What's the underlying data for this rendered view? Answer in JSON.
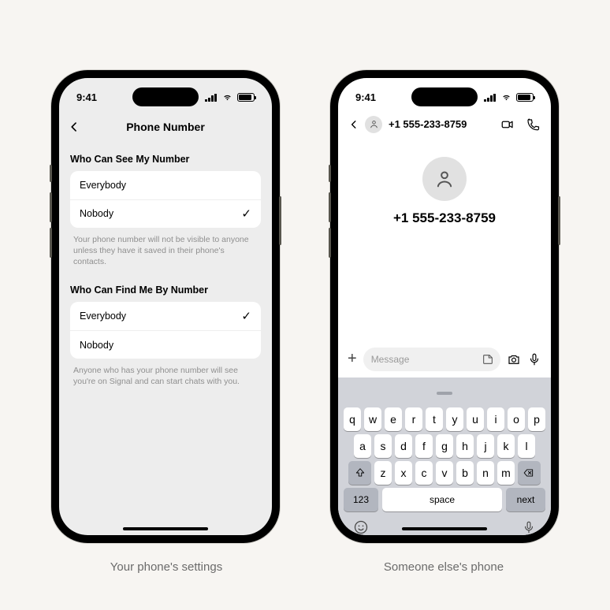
{
  "status_time": "9:41",
  "left": {
    "caption": "Your phone's settings",
    "nav_title": "Phone Number",
    "see_section_title": "Who Can See My Number",
    "see_options": {
      "everybody": "Everybody",
      "nobody": "Nobody",
      "selected": "nobody"
    },
    "see_helper": "Your phone number will not be visible to anyone unless they have it saved in their phone's contacts.",
    "find_section_title": "Who Can Find Me By Number",
    "find_options": {
      "everybody": "Everybody",
      "nobody": "Nobody",
      "selected": "everybody"
    },
    "find_helper": "Anyone who has your phone number will see you're on Signal and can start chats with you."
  },
  "right": {
    "caption": "Someone else's phone",
    "contact_title": "+1 555-233-8759",
    "contact_display": "+1 555-233-8759",
    "message_placeholder": "Message",
    "kbd_row1": [
      "q",
      "w",
      "e",
      "r",
      "t",
      "y",
      "u",
      "i",
      "o",
      "p"
    ],
    "kbd_row2": [
      "a",
      "s",
      "d",
      "f",
      "g",
      "h",
      "j",
      "k",
      "l"
    ],
    "kbd_row3": [
      "z",
      "x",
      "c",
      "v",
      "b",
      "n",
      "m"
    ],
    "kbd_123": "123",
    "kbd_space": "space",
    "kbd_next": "next"
  }
}
